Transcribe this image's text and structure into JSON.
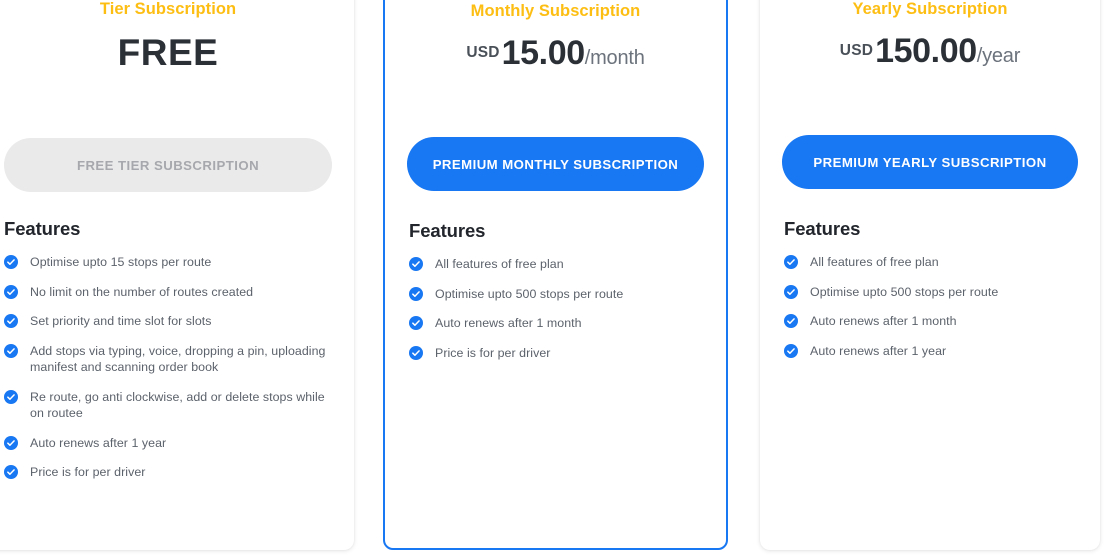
{
  "theme": {
    "accent_yellow": "#FDBE14",
    "accent_blue": "#1877F2",
    "price_text": "#2B3037",
    "feature_text": "#5C626B",
    "disabled_bg": "#EAEAEA",
    "disabled_text": "#A6A8AD",
    "page_bg": "#FFFFFF"
  },
  "features_heading": "Features",
  "check_icon_name": "check-circle-icon",
  "plans": [
    {
      "id": "free",
      "title": "Tier Subscription",
      "price": {
        "style": "free",
        "free_label": "FREE",
        "currency": "",
        "amount": "",
        "period": ""
      },
      "cta": {
        "label": "FREE TIER SUBSCRIPTION",
        "state": "disabled"
      },
      "highlighted": false,
      "features": [
        "Optimise upto 15 stops per route",
        "No limit on the number of routes created",
        "Set priority and time slot for slots",
        "Add stops via typing, voice, dropping a pin, uploading manifest and scanning order book",
        "Re route, go anti clockwise, add or delete stops while on routee",
        "Auto renews after 1 year",
        "Price is for per driver"
      ]
    },
    {
      "id": "monthly",
      "title": "Monthly Subscription",
      "price": {
        "style": "amount",
        "free_label": "",
        "currency": "USD",
        "amount": "15.00",
        "period": "/month"
      },
      "cta": {
        "label": "PREMIUM MONTHLY SUBSCRIPTION",
        "state": "primary"
      },
      "highlighted": true,
      "features": [
        "All features of free plan",
        "Optimise upto 500 stops per route",
        "Auto renews after 1 month",
        "Price is for per driver"
      ]
    },
    {
      "id": "yearly",
      "title": "Yearly Subscription",
      "price": {
        "style": "amount",
        "free_label": "",
        "currency": "USD",
        "amount": "150.00",
        "period": "/year"
      },
      "cta": {
        "label": "PREMIUM YEARLY SUBSCRIPTION",
        "state": "primary"
      },
      "highlighted": false,
      "features": [
        "All features of free plan",
        "Optimise upto 500 stops per route",
        "Auto renews after 1 month",
        "Auto renews after 1 year"
      ]
    }
  ]
}
